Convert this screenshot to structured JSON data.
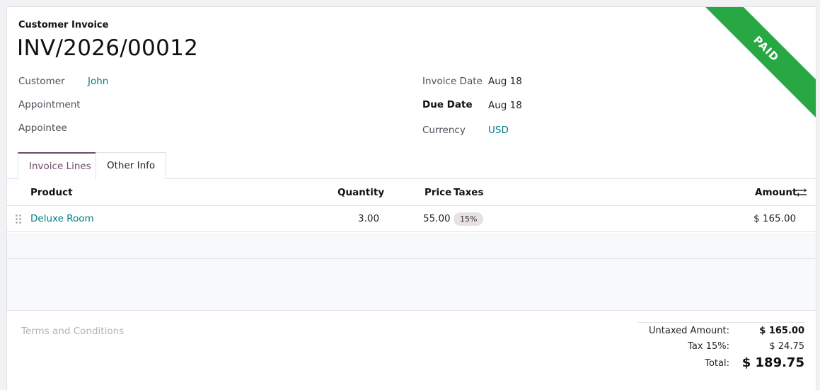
{
  "invoice": {
    "type_label": "Customer Invoice",
    "number": "INV/2026/00012",
    "status_ribbon": "PAID",
    "ribbon_color": "#28a745"
  },
  "fields": {
    "customer_label": "Customer",
    "customer_value": "John",
    "appointment_label": "Appointment",
    "appointee_label": "Appointee",
    "invoice_date_label": "Invoice Date",
    "invoice_date_value": "Aug 18",
    "due_date_label": "Due Date",
    "due_date_value": "Aug 18",
    "currency_label": "Currency",
    "currency_value": "USD"
  },
  "tabs": [
    {
      "label": "Invoice Lines",
      "active": true
    },
    {
      "label": "Other Info",
      "active": false
    }
  ],
  "table": {
    "headers": {
      "product": "Product",
      "quantity": "Quantity",
      "price": "Price",
      "taxes": "Taxes",
      "amount": "Amount"
    },
    "rows": [
      {
        "product": "Deluxe Room",
        "quantity": "3.00",
        "price": "55.00",
        "taxes": "15%",
        "amount": "$ 165.00"
      }
    ],
    "settings_icon": "sliders-icon"
  },
  "terms_placeholder": "Terms and Conditions",
  "totals": {
    "untaxed_label": "Untaxed Amount:",
    "untaxed_value": "$ 165.00",
    "tax_label": "Tax 15%:",
    "tax_value": "$ 24.75",
    "total_label": "Total:",
    "total_value": "$ 189.75"
  },
  "colors": {
    "accent": "#714b67",
    "link": "#017e84"
  }
}
